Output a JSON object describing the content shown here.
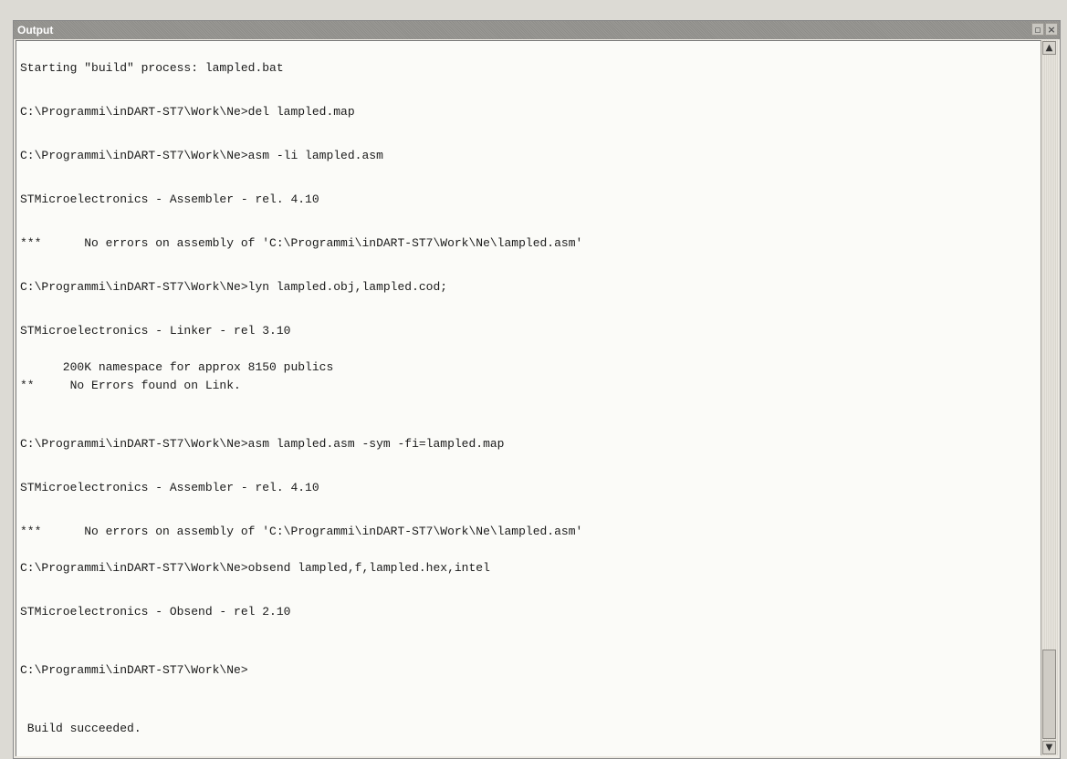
{
  "window": {
    "title": "Output",
    "restore_symbol": "▫",
    "close_symbol": "×"
  },
  "console": {
    "lines": [
      "Starting \"build\" process: lampled.bat",
      "C:\\Programmi\\inDART-ST7\\Work\\Ne>del lampled.map",
      "C:\\Programmi\\inDART-ST7\\Work\\Ne>asm -li lampled.asm",
      "STMicroelectronics - Assembler - rel. 4.10",
      "***      No errors on assembly of 'C:\\Programmi\\inDART-ST7\\Work\\Ne\\lampled.asm'",
      "C:\\Programmi\\inDART-ST7\\Work\\Ne>lyn lampled.obj,lampled.cod;",
      "STMicroelectronics - Linker - rel 3.10",
      "      200K namespace for approx 8150 publics",
      "**     No Errors found on Link.",
      "C:\\Programmi\\inDART-ST7\\Work\\Ne>asm lampled.asm -sym -fi=lampled.map",
      "STMicroelectronics - Assembler - rel. 4.10",
      "***      No errors on assembly of 'C:\\Programmi\\inDART-ST7\\Work\\Ne\\lampled.asm'",
      "C:\\Programmi\\inDART-ST7\\Work\\Ne>obsend lampled,f,lampled.hex,intel",
      "STMicroelectronics - Obsend - rel 2.10",
      "C:\\Programmi\\inDART-ST7\\Work\\Ne>",
      " Build succeeded."
    ]
  },
  "scrollbar": {
    "up_icon": "▲",
    "down_icon": "▼",
    "position_fraction": 0.88
  }
}
